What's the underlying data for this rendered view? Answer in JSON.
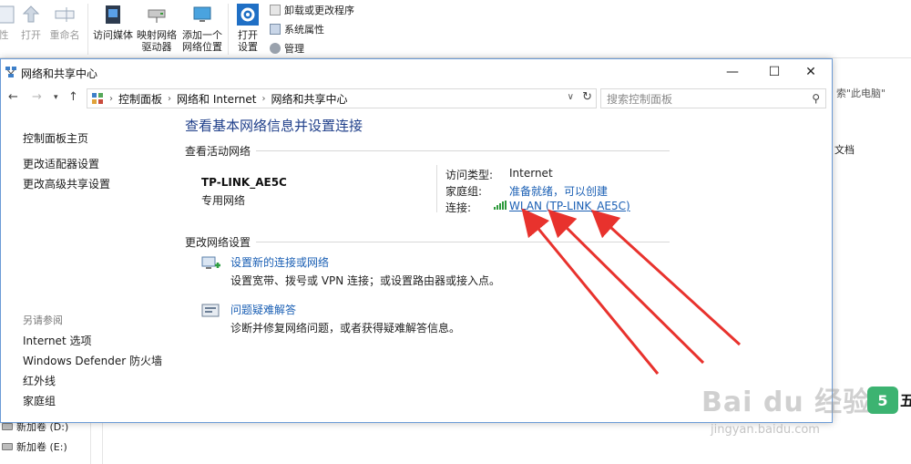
{
  "ribbon": {
    "items": [
      {
        "label": "性"
      },
      {
        "label": "打开"
      },
      {
        "label": "重命名"
      },
      {
        "label": "访问媒体"
      },
      {
        "label": "映射网络驱动器"
      },
      {
        "label": "添加一个网络位置"
      },
      {
        "label": "打开设置"
      }
    ],
    "small": [
      "卸载或更改程序",
      "系统属性",
      "管理"
    ]
  },
  "background": {
    "search_hint": "索\"此电脑\"",
    "doc": "文档",
    "drives": [
      "新加卷 (D:)",
      "新加卷 (E:)"
    ]
  },
  "window": {
    "title": "网络和共享中心",
    "controls": {
      "minimize": "—",
      "maximize": "☐",
      "close": "✕"
    }
  },
  "address": {
    "crumbs": [
      "控制面板",
      "网络和 Internet",
      "网络和共享中心"
    ],
    "search_placeholder": "搜索控制面板"
  },
  "left": {
    "links": [
      "控制面板主页",
      "更改适配器设置",
      "更改高级共享设置"
    ],
    "see_also_title": "另请参阅",
    "see_also": [
      "Internet 选项",
      "Windows Defender 防火墙",
      "红外线",
      "家庭组"
    ]
  },
  "main": {
    "title": "查看基本网络信息并设置连接",
    "active_section": "查看活动网络",
    "network_name": "TP-LINK_AE5C",
    "network_type": "专用网络",
    "access_type_label": "访问类型:",
    "access_type_value": "Internet",
    "homegroup_label": "家庭组:",
    "homegroup_value": "准备就绪，可以创建",
    "connection_label": "连接:",
    "connection_value": "WLAN (TP-LINK_AE5C)",
    "change_section": "更改网络设置",
    "tasks": [
      {
        "link": "设置新的连接或网络",
        "desc": "设置宽带、拨号或 VPN 连接；或设置路由器或接入点。"
      },
      {
        "link": "问题疑难解答",
        "desc": "诊断并修复网络问题，或者获得疑难解答信息。"
      }
    ]
  },
  "watermark": {
    "text": "Bai du 经验",
    "url": "jingyan.baidu.com",
    "badge": "5",
    "badge_text": "五"
  },
  "colors": {
    "link": "#1a5fb4",
    "title": "#1f3f8a",
    "arrow": "#e8322d",
    "window_border": "#6b9bd6"
  }
}
